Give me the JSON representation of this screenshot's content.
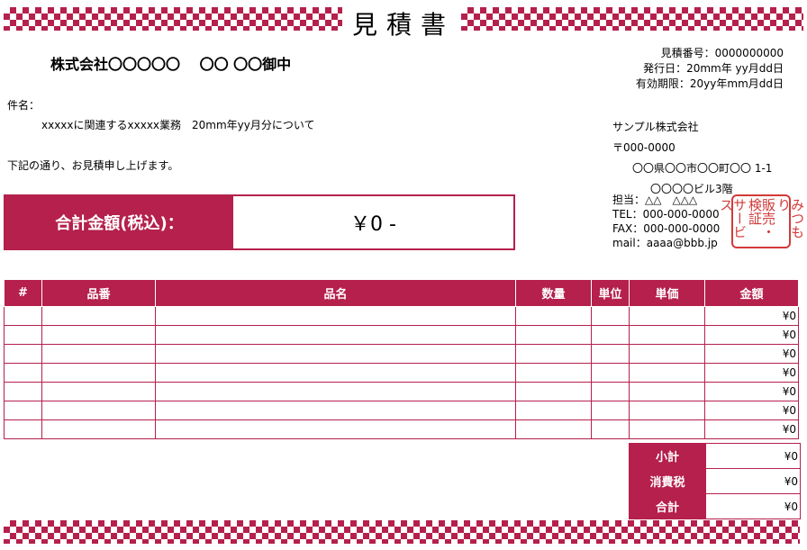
{
  "header": {
    "title": "見積書"
  },
  "client": {
    "name": "株式会社〇〇〇〇〇　 〇〇 〇〇御中"
  },
  "meta": {
    "number_label": "見積番号：",
    "number": "0000000000",
    "date_label": "発行日：",
    "date": "20mm年 yy月dd日",
    "expiry_label": "有効期限：",
    "expiry": "20yy年mm月dd日"
  },
  "subject": {
    "label": "件名：",
    "text": "xxxxxに関連するxxxxx業務　20mm年yy月分について"
  },
  "notice": "下記の通り、お見積申し上げます。",
  "sender": {
    "company": "サンプル株式会社",
    "postal": "〒000-0000",
    "address": "〇〇県〇〇市〇〇町〇〇 1-1",
    "building": "〇〇〇〇ビル3階"
  },
  "contact": {
    "person": "担当：△△　△△△",
    "tel": "TEL：000-000-0000",
    "fax": "FAX：000-000-0000",
    "mail": "mail：aaaa@bbb.jp"
  },
  "stamp": {
    "col1": "みつもり",
    "col2": "販売・検証",
    "col3": "サービス"
  },
  "total": {
    "label": "合計金額(税込)：",
    "value": "￥0 -"
  },
  "table": {
    "headers": [
      "#",
      "品番",
      "品名",
      "数量",
      "単位",
      "単価",
      "金額"
    ],
    "rows": [
      {
        "amount": "¥0"
      },
      {
        "amount": "¥0"
      },
      {
        "amount": "¥0"
      },
      {
        "amount": "¥0"
      },
      {
        "amount": "¥0"
      },
      {
        "amount": "¥0"
      },
      {
        "amount": "¥0"
      }
    ]
  },
  "summary": {
    "subtotal_label": "小計",
    "subtotal": "¥0",
    "tax_label": "消費税",
    "tax": "¥0",
    "total_label": "合計",
    "total": "¥0"
  },
  "colors": {
    "accent": "#b5204d",
    "stamp": "#d23a3a"
  }
}
